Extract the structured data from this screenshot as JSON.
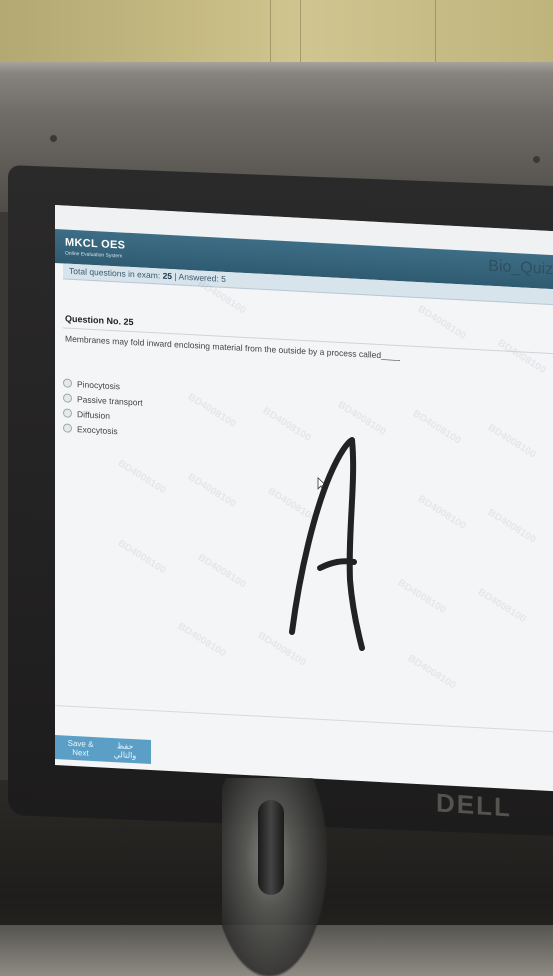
{
  "app": {
    "brand": "MKCL OES",
    "brand_sub": "Online Evaluation System",
    "quiz_name": "Bio_Quiz2_"
  },
  "exam_status": {
    "total_label": "Total questions in exam:",
    "total_value": "25",
    "separator": "|",
    "answered_label": "Answered:",
    "answered_value": "5"
  },
  "question": {
    "number_label": "Question No. 25",
    "text": "Membranes may fold inward enclosing material from the outside by a process called____",
    "options": [
      {
        "label": "Pinocytosis"
      },
      {
        "label": "Passive transport"
      },
      {
        "label": "Diffusion"
      },
      {
        "label": "Exocytosis"
      }
    ]
  },
  "actions": {
    "save_next_label": "Save & Next",
    "save_next_label_ar": "حفظ والتالي"
  },
  "watermark_text": "BD4008100",
  "monitor_brand": "DELL",
  "handwritten_answer": "A",
  "colors": {
    "header": "#2f5b71",
    "button": "#5b9fc6",
    "info_bar": "#d8e4ec"
  }
}
